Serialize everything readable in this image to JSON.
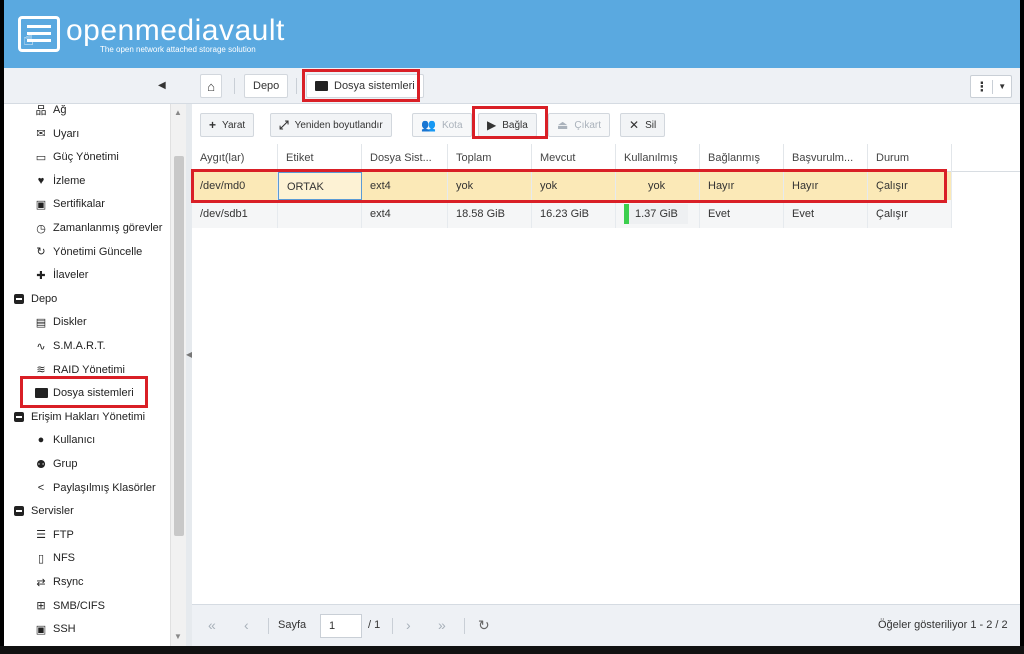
{
  "app": {
    "name": "openmediavault",
    "tagline": "The open network attached storage solution"
  },
  "breadcrumb": {
    "items": [
      "Depo",
      "Dosya sistemleri"
    ]
  },
  "sidebar": {
    "items": [
      {
        "label": "Ağ",
        "icon": "network-icon"
      },
      {
        "label": "Uyarı",
        "icon": "envelope-icon"
      },
      {
        "label": "Güç Yönetimi",
        "icon": "battery-icon"
      },
      {
        "label": "İzleme",
        "icon": "heart-pulse-icon"
      },
      {
        "label": "Sertifikalar",
        "icon": "certificate-icon"
      },
      {
        "label": "Zamanlanmış görevler",
        "icon": "clock-icon"
      },
      {
        "label": "Yönetimi Güncelle",
        "icon": "refresh-icon"
      },
      {
        "label": "İlaveler",
        "icon": "puzzle-icon"
      },
      {
        "label": "Depo",
        "icon": "collapse-icon",
        "group": true
      },
      {
        "label": "Diskler",
        "icon": "disk-icon"
      },
      {
        "label": "S.M.A.R.T.",
        "icon": "pulse-icon"
      },
      {
        "label": "RAID Yönetimi",
        "icon": "database-icon"
      },
      {
        "label": "Dosya sistemleri",
        "icon": "folder-icon",
        "selected": true
      },
      {
        "label": "Erişim Hakları Yönetimi",
        "icon": "collapse-icon",
        "group": true
      },
      {
        "label": "Kullanıcı",
        "icon": "user-icon"
      },
      {
        "label": "Grup",
        "icon": "group-icon"
      },
      {
        "label": "Paylaşılmış Klasörler",
        "icon": "share-icon"
      },
      {
        "label": "Servisler",
        "icon": "collapse-icon",
        "group": true
      },
      {
        "label": "FTP",
        "icon": "server-icon"
      },
      {
        "label": "NFS",
        "icon": "file-icon"
      },
      {
        "label": "Rsync",
        "icon": "sync-icon"
      },
      {
        "label": "SMB/CIFS",
        "icon": "windows-icon"
      },
      {
        "label": "SSH",
        "icon": "terminal-icon"
      }
    ]
  },
  "toolbar": {
    "create": "Yarat",
    "resize": "Yeniden boyutlandır",
    "quota": "Kota",
    "mount": "Bağla",
    "unmount": "Çıkart",
    "delete": "Sil"
  },
  "table": {
    "columns": [
      "Aygıt(lar)",
      "Etiket",
      "Dosya Sist...",
      "Toplam",
      "Mevcut",
      "Kullanılmış",
      "Bağlanmış",
      "Başvurulm...",
      "Durum"
    ],
    "rows": [
      {
        "device": "/dev/md0",
        "label": "ORTAK",
        "fs": "ext4",
        "total": "yok",
        "available": "yok",
        "used": "yok",
        "mounted": "Hayır",
        "referenced": "Hayır",
        "status": "Çalışır"
      },
      {
        "device": "/dev/sdb1",
        "label": "",
        "fs": "ext4",
        "total": "18.58 GiB",
        "available": "16.23 GiB",
        "used": "1.37 GiB",
        "used_fraction": 0.08,
        "mounted": "Evet",
        "referenced": "Evet",
        "status": "Çalışır"
      }
    ]
  },
  "pager": {
    "page_label": "Sayfa",
    "page_value": "1",
    "page_total": "/ 1",
    "summary": "Öğeler gösteriliyor 1 - 2 / 2"
  },
  "colors": {
    "header": "#5aa9e0",
    "highlight": "#d91f26",
    "selected_row": "#fbe9b7",
    "usage_bar": "#3ccf4e"
  }
}
